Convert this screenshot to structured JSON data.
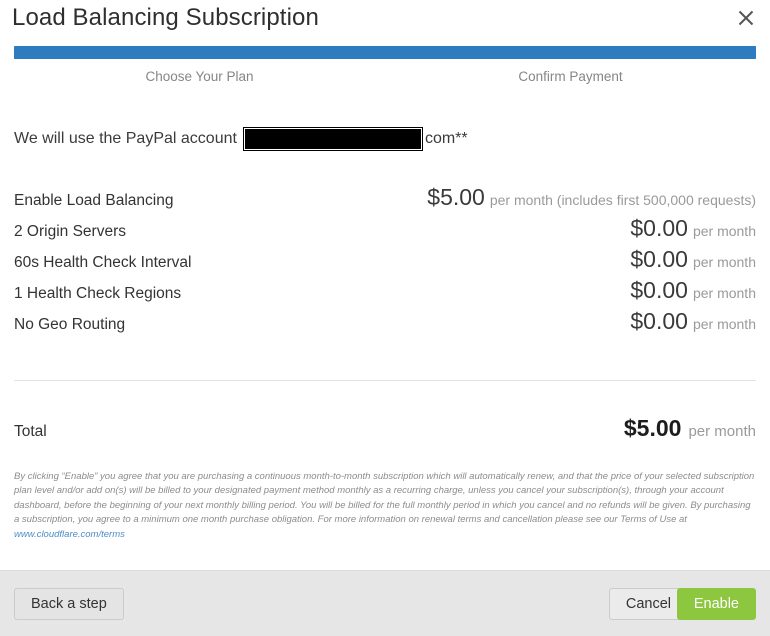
{
  "header": {
    "title": "Load Balancing Subscription",
    "close_icon": "close-icon"
  },
  "stepper": {
    "progress_percent": 100,
    "progress_color": "#2d7cbf",
    "steps": [
      {
        "label": "Choose Your Plan"
      },
      {
        "label": "Confirm Payment"
      }
    ]
  },
  "payment_account": {
    "prefix": "We will use the PayPal account",
    "redacted": "",
    "suffix": "com**"
  },
  "line_items": [
    {
      "name": "Enable Load Balancing",
      "amount": "$5.00",
      "period": "per month (includes first 500,000 requests)"
    },
    {
      "name": "2 Origin Servers",
      "amount": "$0.00",
      "period": "per month"
    },
    {
      "name": "60s Health Check Interval",
      "amount": "$0.00",
      "period": "per month"
    },
    {
      "name": "1 Health Check Regions",
      "amount": "$0.00",
      "period": "per month"
    },
    {
      "name": "No Geo Routing",
      "amount": "$0.00",
      "period": "per month"
    }
  ],
  "total": {
    "label": "Total",
    "amount": "$5.00",
    "period": "per month"
  },
  "fine_print": {
    "text": "By clicking “Enable” you agree that you are purchasing a continuous month-to-month subscription which will automatically renew, and that the price of your selected subscription plan level and/or add on(s) will be billed to your designated payment method monthly as a recurring charge, unless you cancel your subscription(s), through your account dashboard, before the beginning of your next monthly billing period. You will be billed for the full monthly period in which you cancel and no refunds will be given. By purchasing a subscription, you agree to a minimum one month purchase obligation. For more information on renewal terms and cancellation please see our Terms of Use at ",
    "link_text": "www.cloudflare.com/terms",
    "link_color": "#4d8cc8"
  },
  "footer": {
    "back_label": "Back a step",
    "cancel_label": "Cancel",
    "enable_label": "Enable",
    "enable_color": "#8dc63f"
  }
}
